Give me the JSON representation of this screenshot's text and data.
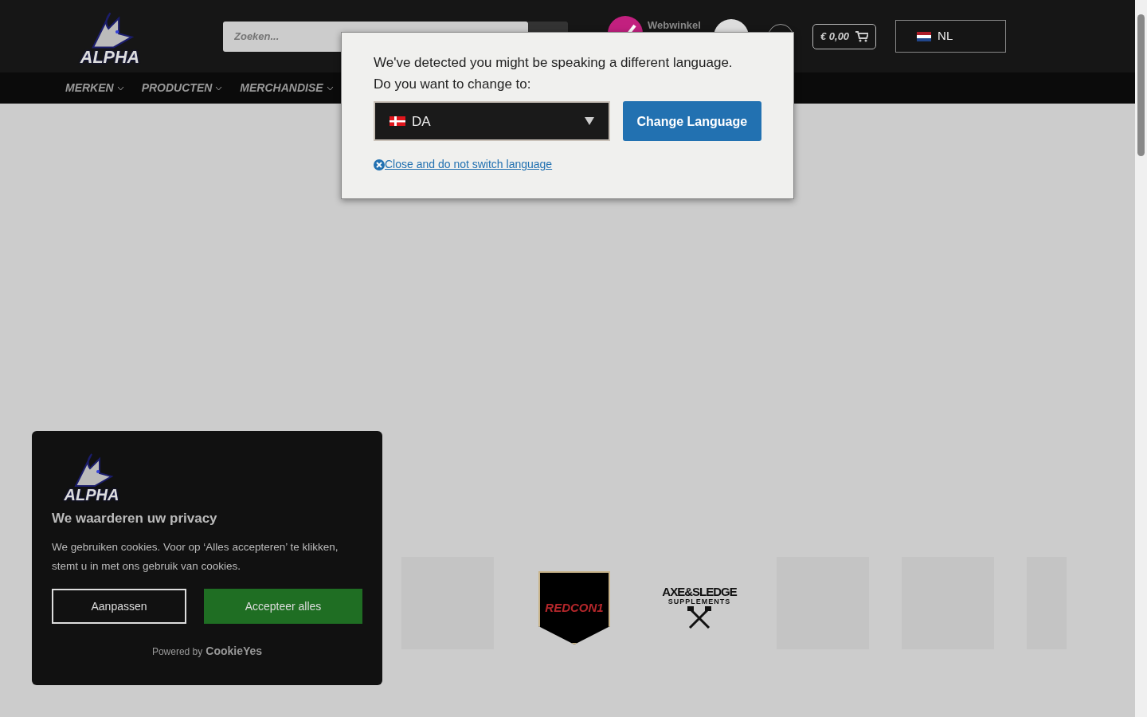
{
  "header": {
    "logo_text": "ALPHA",
    "search": {
      "placeholder": "Zoeken..."
    },
    "trust_badge": "Webwinkel",
    "cart": "€ 0,00",
    "language": {
      "code": "NL"
    }
  },
  "nav": [
    {
      "label": "MERKEN"
    },
    {
      "label": "PRODUCTEN"
    },
    {
      "label": "MERCHANDISE"
    }
  ],
  "language_modal": {
    "message": "We've detected you might be speaking a different language.",
    "question": "Do you want to change to:",
    "select": {
      "code": "DA"
    },
    "button": "Change Language",
    "close_link": "Close and do not switch language"
  },
  "brands": [
    {
      "kind": "placeholder"
    },
    {
      "kind": "redcon",
      "name": "REDCON1"
    },
    {
      "kind": "axe",
      "name": "AXE&SLEDGE",
      "sub": "SUPPLEMENTS"
    },
    {
      "kind": "placeholder"
    },
    {
      "kind": "placeholder"
    },
    {
      "kind": "partial"
    }
  ],
  "cookie_banner": {
    "logo_text": "ALPHA",
    "title": "We waarderen uw privacy",
    "text": "We gebruiken cookies. Voor op ‘Alles accepteren’ te klikken, stemt u in met ons gebruik van cookies.",
    "buttons": [
      {
        "label": "Aanpassen",
        "kind": "outline"
      },
      {
        "label": "Accepteer alles",
        "kind": "accept"
      }
    ],
    "powered_by": "Powered by",
    "powered_brand": "CookieYes"
  }
}
